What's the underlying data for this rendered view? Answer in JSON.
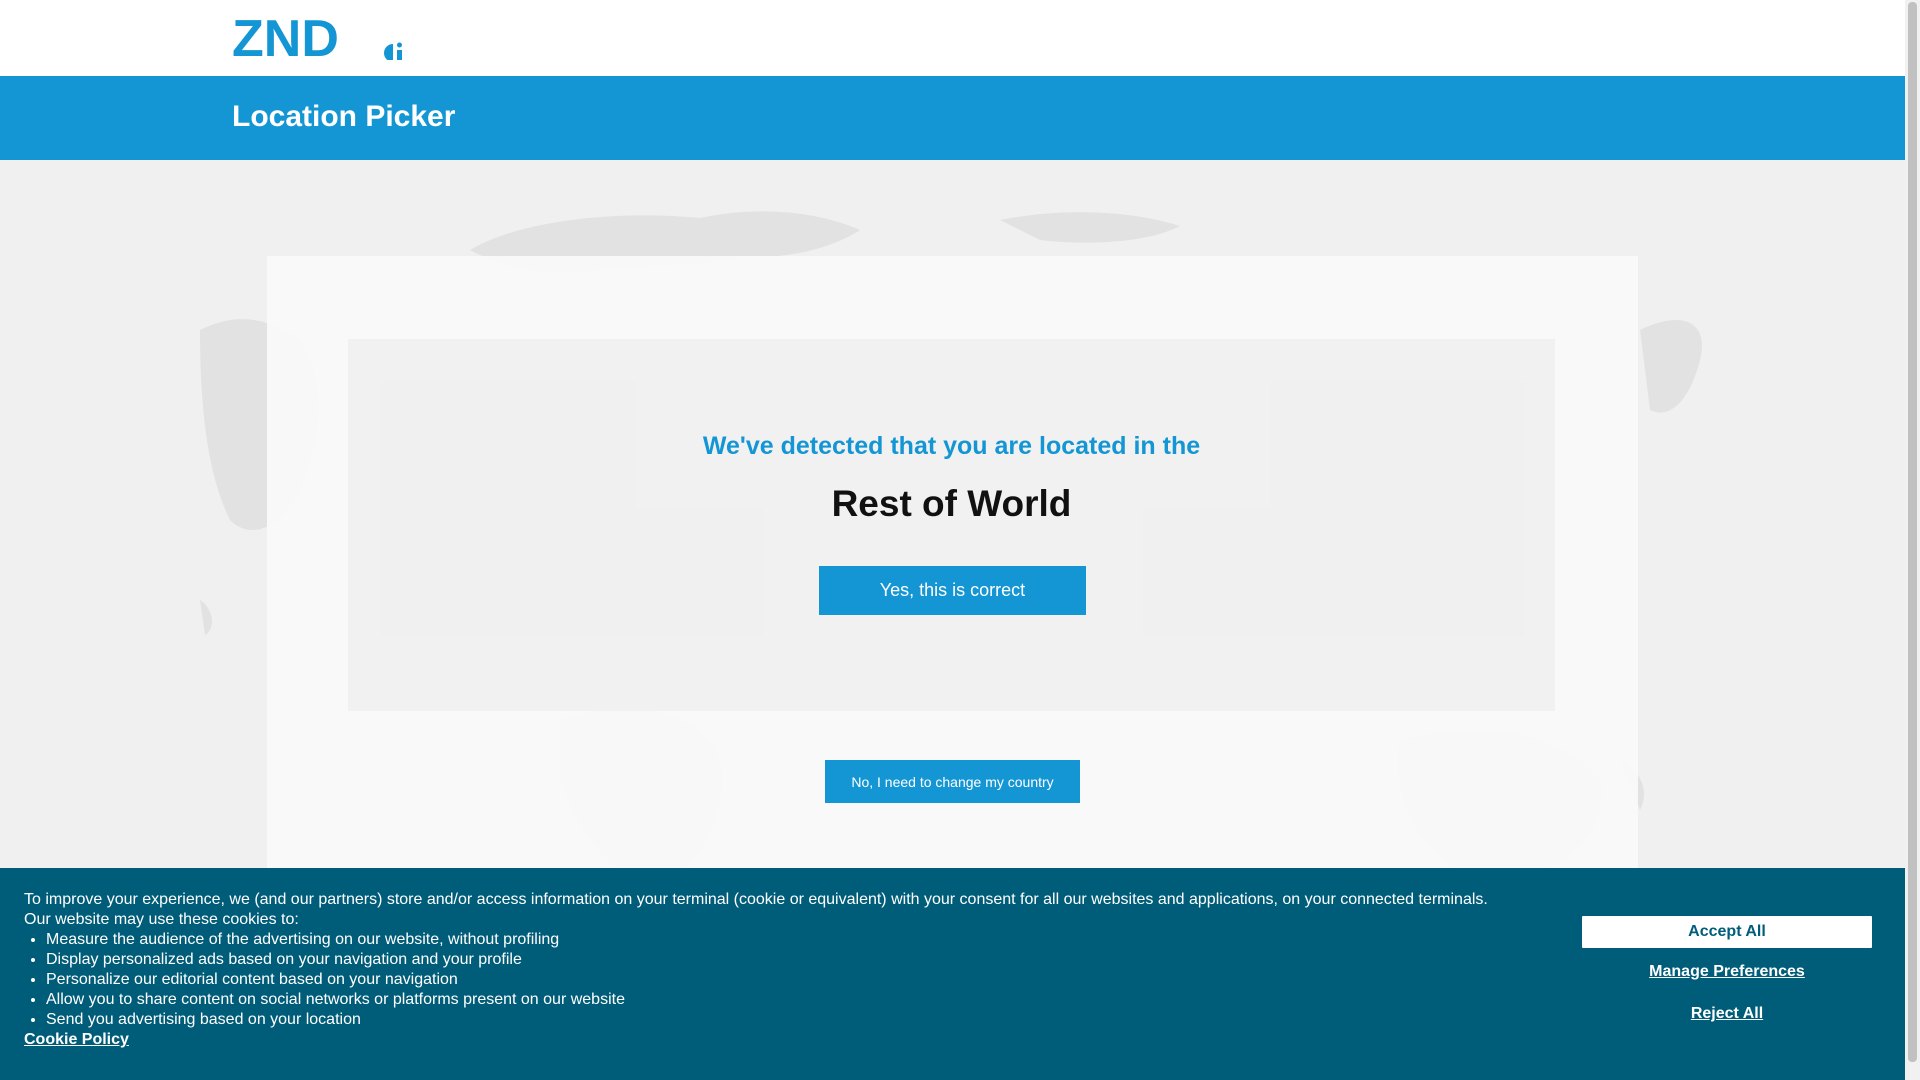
{
  "header": {
    "logo_text": "ZND",
    "brand_color": "#1496d4"
  },
  "titlebar": {
    "title": "Location Picker"
  },
  "location": {
    "detected_text": "We've detected that you are located in the",
    "region": "Rest of World",
    "confirm_label": "Yes, this is correct",
    "change_label": "No, I need to change my country"
  },
  "cookie": {
    "intro": "To improve your experience, we (and our partners) store and/or access information on your terminal (cookie or equivalent) with your consent for all our websites and applications, on your connected terminals.",
    "intro2": "Our website may use these cookies to:",
    "items": [
      "Measure the audience of the advertising on our website, without profiling",
      "Display personalized ads based on your navigation and your profile",
      "Personalize our editorial content based on your navigation",
      "Allow you to share content on social networks or platforms present on our website",
      "Send you advertising based on your location"
    ],
    "policy_link": "Cookie Policy",
    "accept_label": "Accept All",
    "manage_label": "Manage Preferences",
    "reject_label": "Reject All",
    "banner_color": "#005d79"
  }
}
